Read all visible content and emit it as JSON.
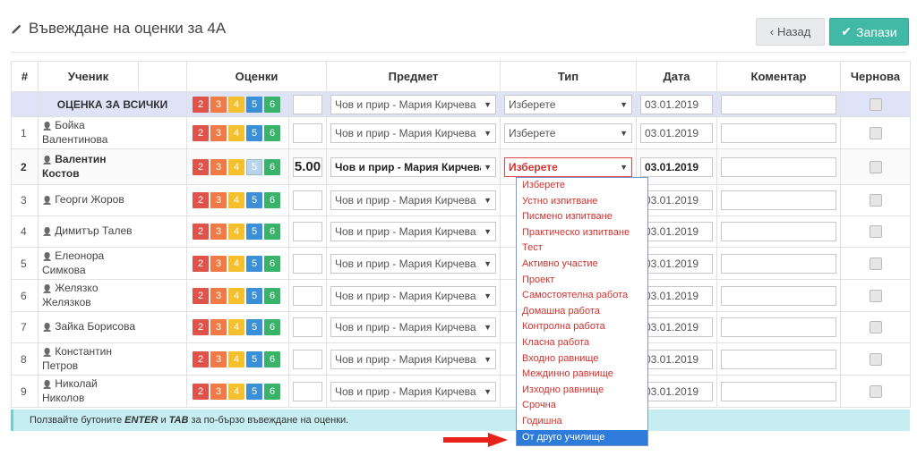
{
  "header": {
    "title": "Въвеждане на оценки за 4А",
    "back_label": "Назад",
    "save_label": "Запази"
  },
  "columns": {
    "num": "#",
    "student": "Ученик",
    "grades": "Оценки",
    "subject": "Предмет",
    "type": "Тип",
    "date": "Дата",
    "comment": "Коментар",
    "draft": "Чернова"
  },
  "all_row": {
    "label": "ОЦЕНКА ЗА ВСИЧКИ",
    "subject": "Чов и прир - Мария Кирчева",
    "type": "Изберете",
    "date": "03.01.2019"
  },
  "grade_buttons": [
    "2",
    "3",
    "4",
    "5",
    "6"
  ],
  "students": [
    {
      "num": "1",
      "name1": "Бойка",
      "name2": "Валентинова",
      "value": "",
      "subject": "Чов и прир - Мария Кирчева",
      "type": "Изберете",
      "date": "03.01.2019"
    },
    {
      "num": "2",
      "name1": "Валентин",
      "name2": "Костов",
      "value": "5.00",
      "subject": "Чов и прир - Мария Кирчева",
      "type": "Изберете",
      "date": "03.01.2019"
    },
    {
      "num": "3",
      "name1": "Георги Жоров",
      "name2": "",
      "value": "",
      "subject": "Чов и прир - Мария Кирчева",
      "date": "03.01.2019"
    },
    {
      "num": "4",
      "name1": "Димитър Талев",
      "name2": "",
      "value": "",
      "subject": "Чов и прир - Мария Кирчева",
      "date": "03.01.2019"
    },
    {
      "num": "5",
      "name1": "Елеонора",
      "name2": "Симкова",
      "value": "",
      "subject": "Чов и прир - Мария Кирчева",
      "date": "03.01.2019"
    },
    {
      "num": "6",
      "name1": "Желязко",
      "name2": "Желязков",
      "value": "",
      "subject": "Чов и прир - Мария Кирчева",
      "date": "03.01.2019"
    },
    {
      "num": "7",
      "name1": "Зайка Борисова",
      "name2": "",
      "value": "",
      "subject": "Чов и прир - Мария Кирчева",
      "date": "03.01.2019"
    },
    {
      "num": "8",
      "name1": "Константин",
      "name2": "Петров",
      "value": "",
      "subject": "Чов и прир - Мария Кирчева",
      "date": "03.01.2019"
    },
    {
      "num": "9",
      "name1": "Николай",
      "name2": "Николов",
      "value": "",
      "subject": "Чов и прир - Мария Кирчева",
      "date": "03.01.2019"
    }
  ],
  "type_options": [
    "Изберете",
    "Устно изпитване",
    "Писмено изпитване",
    "Практическо изпитване",
    "Тест",
    "Активно участие",
    "Проект",
    "Самостоятелна работа",
    "Домашна работа",
    "Контролна работа",
    "Класна работа",
    "Входно равнище",
    "Междинно равнище",
    "Изходно равнище",
    "Срочна",
    "Годишна",
    "От друго училище"
  ],
  "type_highlighted": "От друго училище",
  "info": {
    "pre": "Ползвайте бутоните",
    "k1": "ENTER",
    "mid": "и",
    "k2": "TAB",
    "post": "за по-бързо въвеждане на оценки."
  },
  "colors": {
    "accent": "#41b9a4",
    "highlight": "#2f7bdc",
    "error": "#d0322e",
    "info_bg": "#c6eef0"
  }
}
